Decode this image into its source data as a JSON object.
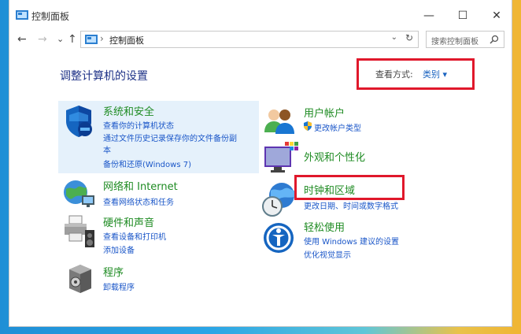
{
  "window": {
    "title": "控制面板",
    "minimize": "—",
    "maximize": "☐",
    "close": "✕"
  },
  "nav": {
    "back": "←",
    "forward": "→",
    "recent": "⌄",
    "up": "↑",
    "breadcrumb_sep": "›",
    "address": "控制面板",
    "address_dropdown": "⌄",
    "refresh": "↻",
    "search_placeholder": "搜索控制面板"
  },
  "main": {
    "heading": "调整计算机的设置",
    "view_by_label": "查看方式:",
    "view_by_value": "类别 ▾"
  },
  "categories": [
    {
      "title": "系统和安全",
      "links": [
        "查看你的计算机状态",
        "通过文件历史记录保存你的文件备份副",
        "本",
        "备份和还原(Windows 7)"
      ]
    },
    {
      "title": "网络和 Internet",
      "links": [
        "查看网络状态和任务"
      ]
    },
    {
      "title": "硬件和声音",
      "links": [
        "查看设备和打印机",
        "添加设备"
      ]
    },
    {
      "title": "程序",
      "links": [
        "卸载程序"
      ]
    },
    {
      "title": "用户帐户",
      "links": [
        "更改帐户类型"
      ]
    },
    {
      "title": "外观和个性化",
      "links": []
    },
    {
      "title": "时钟和区域",
      "links": [
        "更改日期、时间或数字格式"
      ]
    },
    {
      "title": "轻松使用",
      "links": [
        "使用 Windows 建议的设置",
        "优化视觉显示"
      ]
    }
  ],
  "colors": {
    "title_green": "#1e8b22",
    "link_blue": "#1a56c8",
    "heading_navy": "#1e3287",
    "highlight": "#e5f1fb",
    "annotation_red": "#e0182b"
  }
}
